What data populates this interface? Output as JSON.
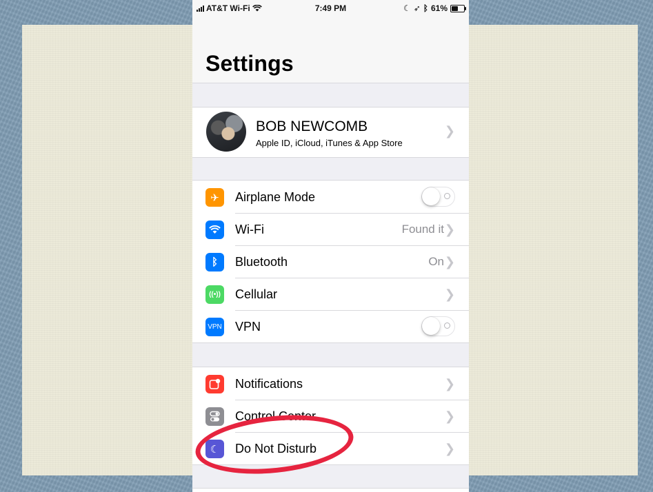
{
  "status_bar": {
    "carrier": "AT&T Wi-Fi",
    "time": "7:49 PM",
    "battery_percent": "61%",
    "battery_level": 0.61
  },
  "header": {
    "title": "Settings"
  },
  "profile": {
    "name": "BOB NEWCOMB",
    "subtitle": "Apple ID, iCloud, iTunes & App Store"
  },
  "network_group": {
    "airplane": {
      "label": "Airplane Mode",
      "icon": "airplane-icon",
      "color": "#ff9500",
      "on": false
    },
    "wifi": {
      "label": "Wi-Fi",
      "value": "Found it",
      "icon": "wifi-icon",
      "color": "#007aff"
    },
    "bluetooth": {
      "label": "Bluetooth",
      "value": "On",
      "icon": "bluetooth-icon",
      "color": "#007aff"
    },
    "cellular": {
      "label": "Cellular",
      "icon": "cellular-icon",
      "color": "#4cd964"
    },
    "vpn": {
      "label": "VPN",
      "icon_text": "VPN",
      "color": "#007aff",
      "on": false
    }
  },
  "system_group": {
    "notifications": {
      "label": "Notifications",
      "icon": "notifications-icon",
      "color": "#ff3b30"
    },
    "control_center": {
      "label": "Control Center",
      "icon": "control-center-icon",
      "color": "#8e8e93"
    },
    "do_not_disturb": {
      "label": "Do Not Disturb",
      "icon": "moon-icon",
      "color": "#5856d6"
    }
  },
  "annotation": {
    "color": "#e6243f",
    "target": "do_not_disturb"
  }
}
